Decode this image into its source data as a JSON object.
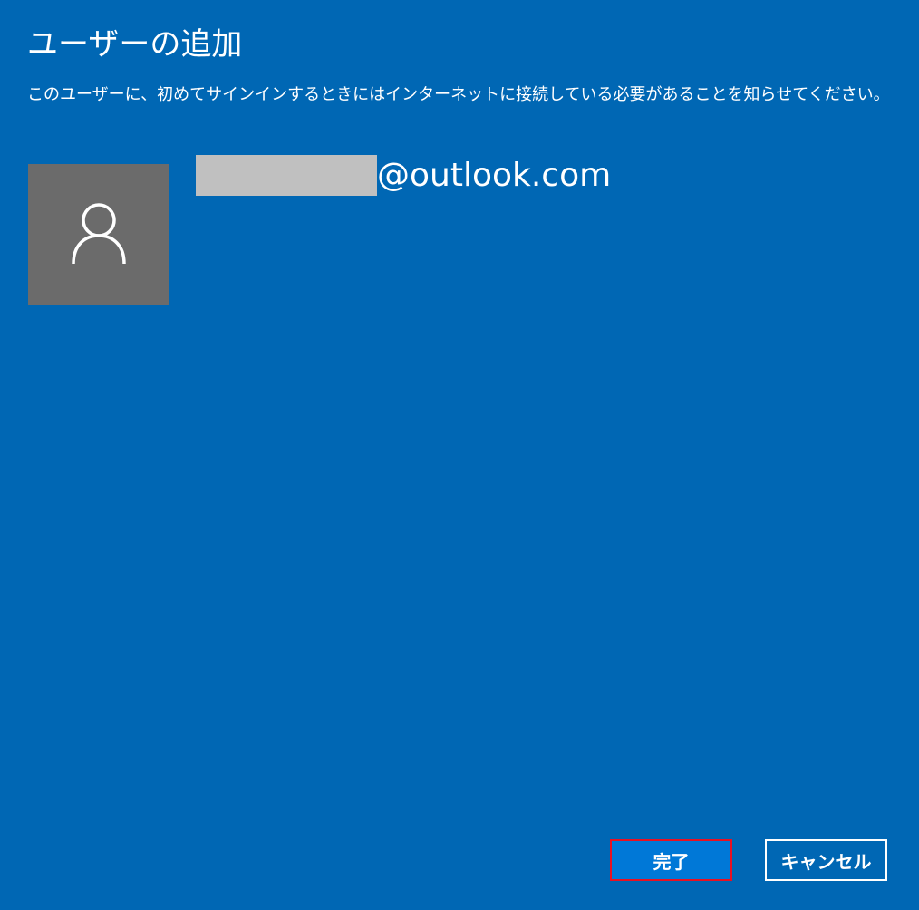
{
  "dialog": {
    "title": "ユーザーの追加",
    "message": "このユーザーに、初めてサインインするときにはインターネットに接続している必要があることを知らせてください。"
  },
  "account": {
    "avatar_icon": "user-silhouette-icon",
    "email_domain": "@outlook.com"
  },
  "buttons": {
    "finish_label": "完了",
    "cancel_label": "キャンセル"
  },
  "colors": {
    "background": "#0067b4",
    "avatar_bg": "#6b6b6b",
    "primary_button": "#0078d7",
    "focus_border": "#e81123"
  }
}
